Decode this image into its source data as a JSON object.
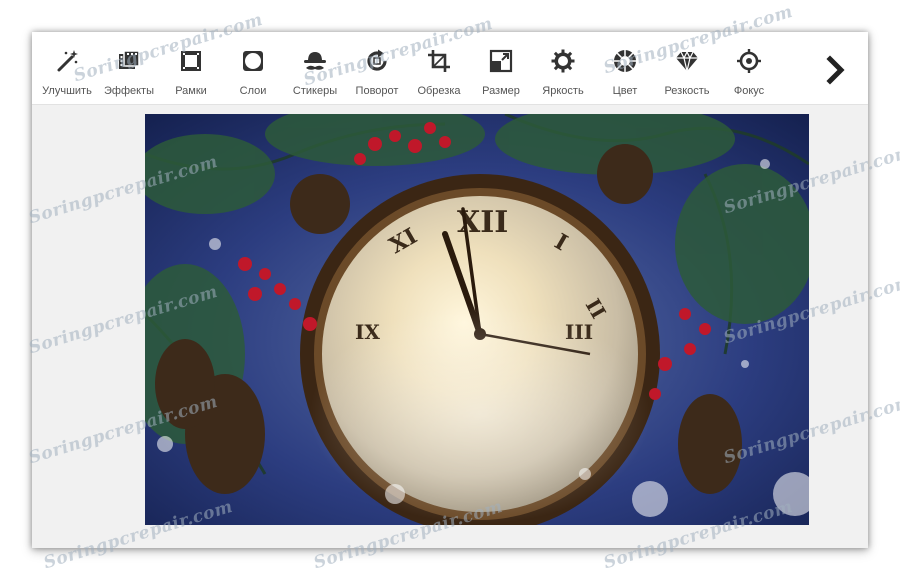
{
  "toolbar": {
    "tools": [
      {
        "label": "Улучшить",
        "icon": "magic-wand-icon"
      },
      {
        "label": "Эффекты",
        "icon": "film-icon"
      },
      {
        "label": "Рамки",
        "icon": "frame-icon"
      },
      {
        "label": "Слои",
        "icon": "layers-icon"
      },
      {
        "label": "Стикеры",
        "icon": "hat-mustache-icon"
      },
      {
        "label": "Поворот",
        "icon": "rotate-icon"
      },
      {
        "label": "Обрезка",
        "icon": "crop-icon"
      },
      {
        "label": "Размер",
        "icon": "resize-icon"
      },
      {
        "label": "Яркость",
        "icon": "sun-icon"
      },
      {
        "label": "Цвет",
        "icon": "color-wheel-icon"
      },
      {
        "label": "Резкость",
        "icon": "diamond-icon"
      },
      {
        "label": "Фокус",
        "icon": "target-icon"
      }
    ],
    "next_icon": "chevron-right-icon"
  },
  "watermark": {
    "text": "Soringpcrepair.com"
  },
  "colors": {
    "icon": "#333333",
    "label": "#555555",
    "canvas": "#f1f1f1",
    "toolbar": "#ffffff"
  }
}
